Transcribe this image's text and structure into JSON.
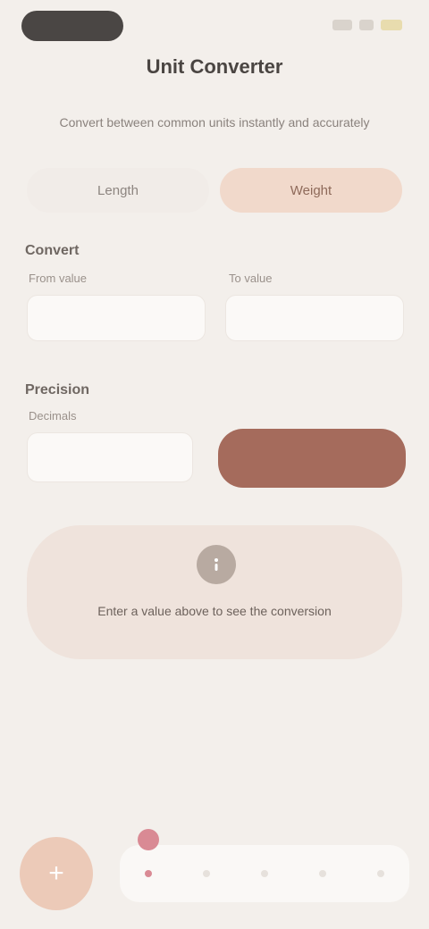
{
  "status": {
    "pill": ""
  },
  "header": {
    "title": "Unit Converter",
    "subtitle": "Convert between common units instantly and accurately"
  },
  "segments": [
    {
      "label": "Length"
    },
    {
      "label": "Weight",
      "active": true
    }
  ],
  "convert": {
    "section_label": "Convert",
    "from_label": "From value",
    "to_label": "To value",
    "from_placeholder": "",
    "to_placeholder": ""
  },
  "precision": {
    "section_label": "Precision",
    "field_label": "Decimals",
    "input_placeholder": "",
    "apply_label": ""
  },
  "hint": {
    "icon": "info-icon",
    "text": "Enter a value above to see the conversion"
  },
  "nav": {
    "fab_icon": "plus-icon",
    "tabs": [
      "tab-1",
      "tab-2",
      "tab-3",
      "tab-4",
      "tab-5"
    ]
  }
}
